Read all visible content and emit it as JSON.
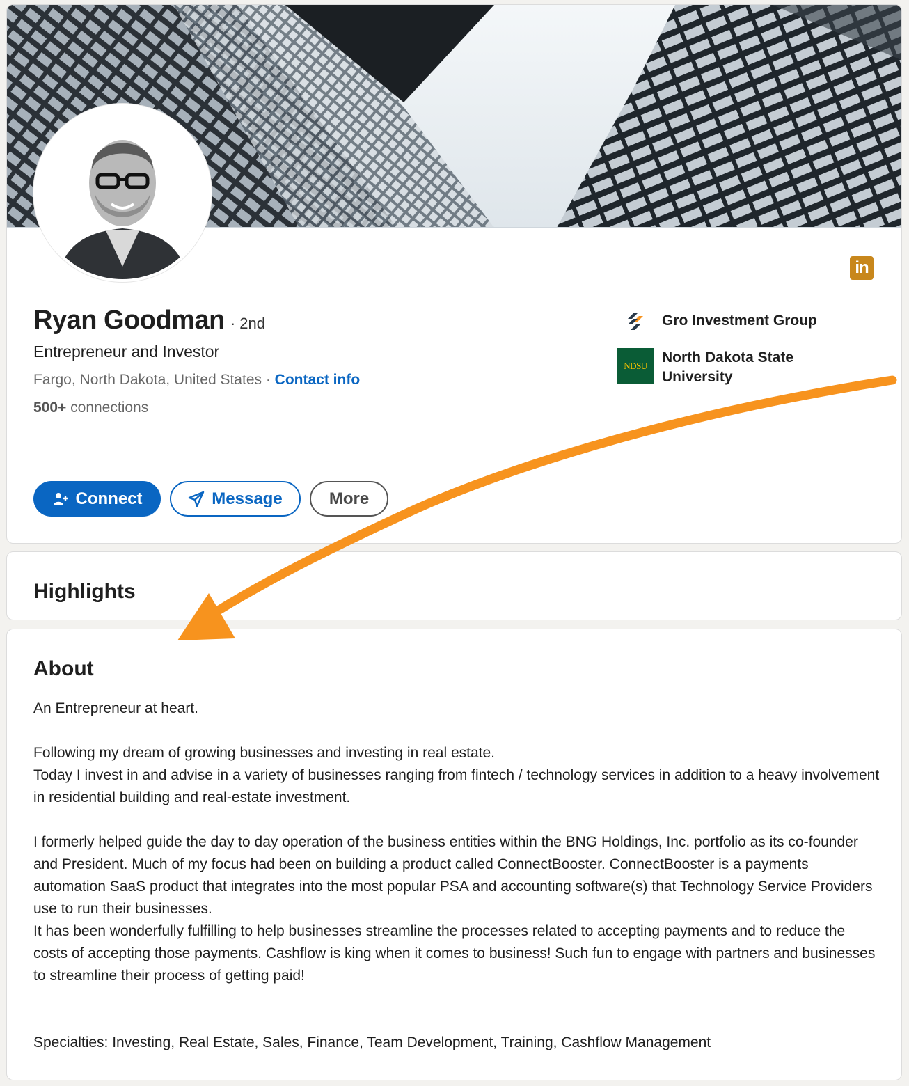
{
  "profile": {
    "name": "Ryan Goodman",
    "degree": "· 2nd",
    "headline": "Entrepreneur and Investor",
    "location": "Fargo, North Dakota, United States",
    "separator": " · ",
    "contact_label": "Contact info",
    "connections_count": "500+",
    "connections_label": " connections",
    "linkedin_badge": "in"
  },
  "orgs": [
    {
      "name": "Gro Investment Group",
      "icon": "gro-logo"
    },
    {
      "name": "North Dakota State University",
      "logo_text": "NDSU"
    }
  ],
  "actions": {
    "connect_label": "Connect",
    "message_label": "Message",
    "more_label": "More"
  },
  "highlights": {
    "title": "Highlights"
  },
  "about": {
    "title": "About",
    "p1": "An Entrepreneur at heart.",
    "p2a": "Following my dream of growing businesses and investing in real estate.",
    "p2b": "Today I invest in and advise in a variety of businesses ranging from fintech / technology services in addition to a heavy involvement in residential building and real-estate investment.",
    "p3a": "I formerly helped guide the day to day operation of the business entities within the BNG Holdings, Inc. portfolio as its co-founder and President. Much of my focus had been on building a product called ConnectBooster. ConnectBooster is a payments automation SaaS product that integrates into the most popular PSA and accounting software(s) that Technology Service Providers use to run their businesses.",
    "p3b": "It has been wonderfully fulfilling to help businesses streamline the processes related to accepting payments and to reduce the costs of accepting those payments. Cashflow is king when it comes to business! Such fun to engage with partners and businesses to streamline their process of getting paid!",
    "p4": "Specialties: Investing, Real Estate, Sales, Finance, Team Development, Training, Cashflow Management"
  },
  "colors": {
    "linkedin_blue": "#0a66c2",
    "annotation_arrow": "#f7931e",
    "badge": "#c8871c",
    "ndsu_green": "#0a5c36"
  }
}
